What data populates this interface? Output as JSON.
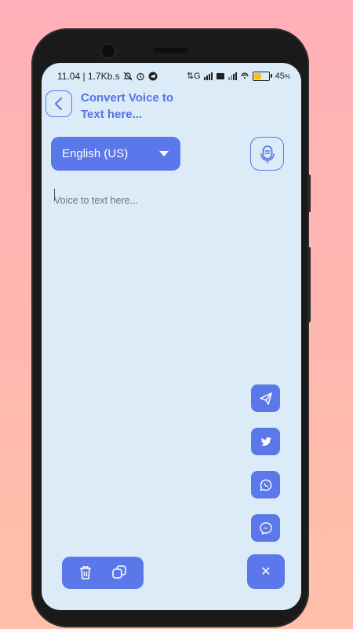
{
  "status": {
    "time_speed": "11.04 | 1.7Kb.s",
    "network": "⇅G",
    "battery": "45",
    "battery_unit": "%"
  },
  "header": {
    "title": "Convert Voice to Text here..."
  },
  "language": {
    "selected": "English (US)"
  },
  "editor": {
    "placeholder": "Voice to text here..."
  },
  "share": {
    "items": [
      "telegram-icon",
      "twitter-icon",
      "whatsapp-icon",
      "messenger-icon"
    ]
  },
  "actions": {
    "close_label": "✕"
  },
  "colors": {
    "accent": "#5b78ea",
    "screen_bg": "#dcebf8"
  }
}
